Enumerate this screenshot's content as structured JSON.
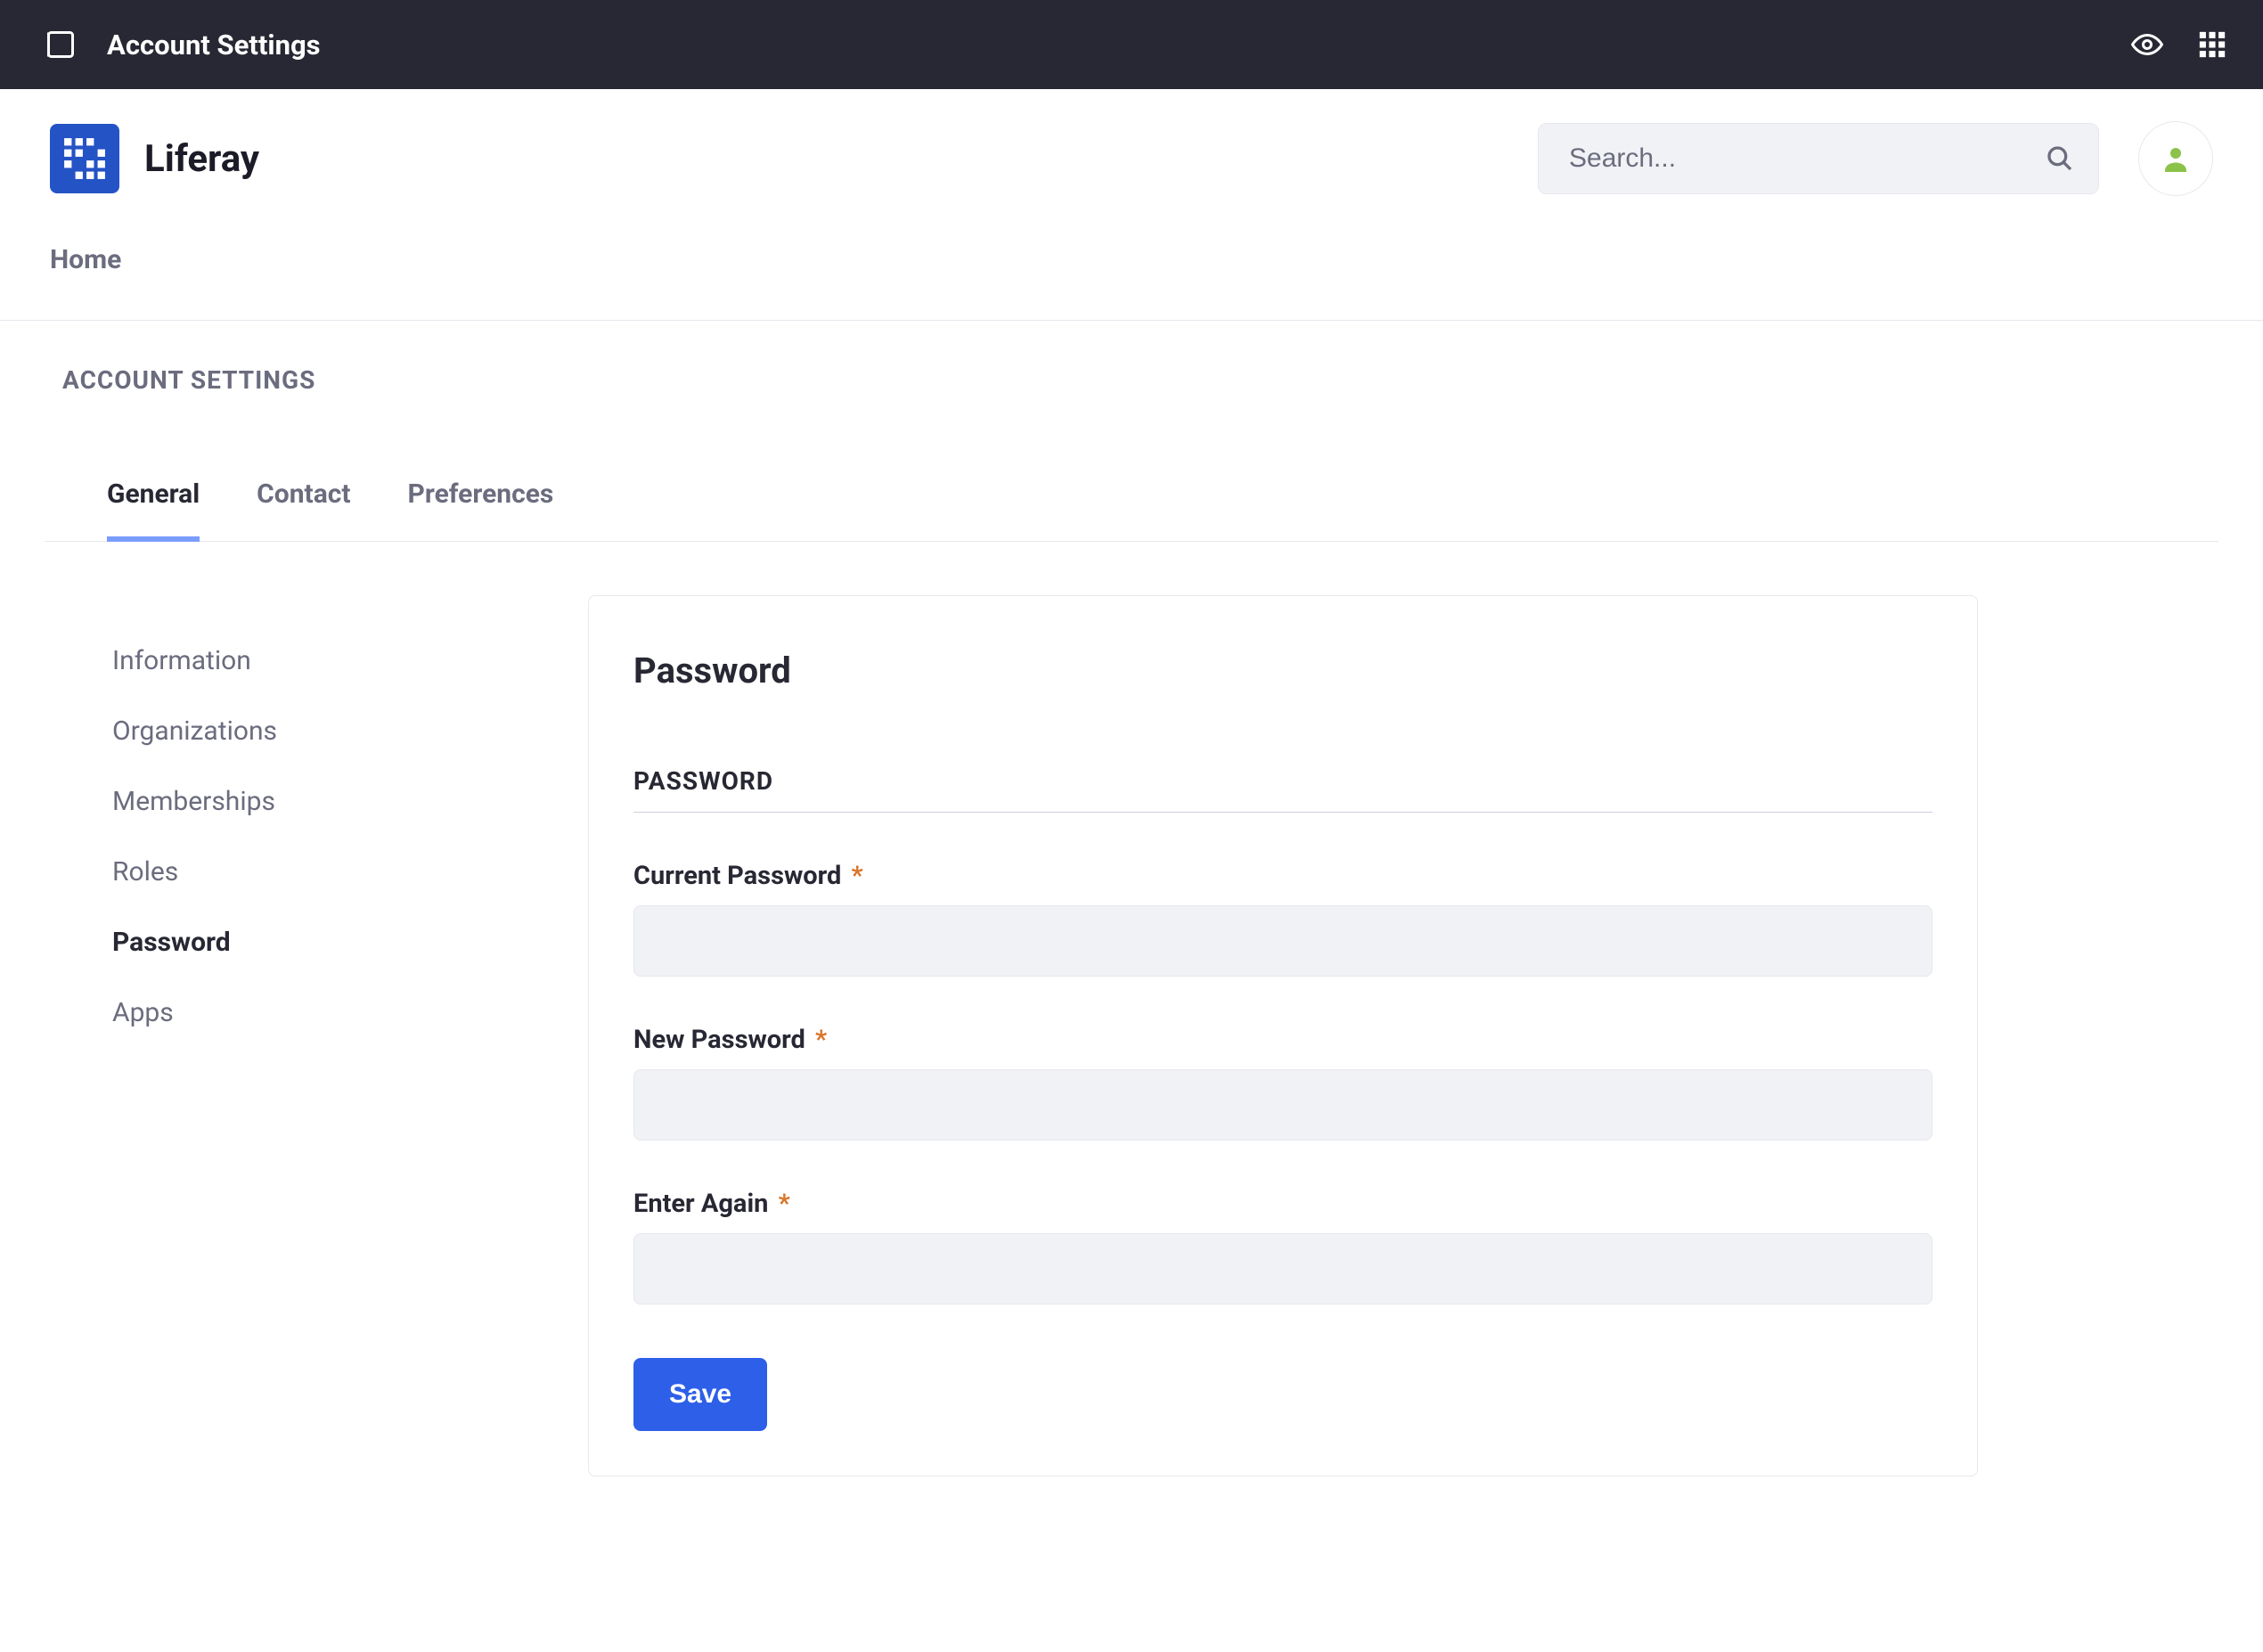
{
  "topbar": {
    "title": "Account Settings"
  },
  "brand": {
    "name": "Liferay"
  },
  "search": {
    "placeholder": "Search..."
  },
  "primary_nav": {
    "home": "Home"
  },
  "breadcrumb": {
    "label": "ACCOUNT SETTINGS"
  },
  "tabs": {
    "general": "General",
    "contact": "Contact",
    "preferences": "Preferences"
  },
  "sidenav": {
    "information": "Information",
    "organizations": "Organizations",
    "memberships": "Memberships",
    "roles": "Roles",
    "password": "Password",
    "apps": "Apps"
  },
  "panel": {
    "title": "Password",
    "fieldset": "PASSWORD",
    "current_label": "Current Password",
    "new_label": "New Password",
    "again_label": "Enter Again",
    "required_mark": "*",
    "save_label": "Save"
  }
}
